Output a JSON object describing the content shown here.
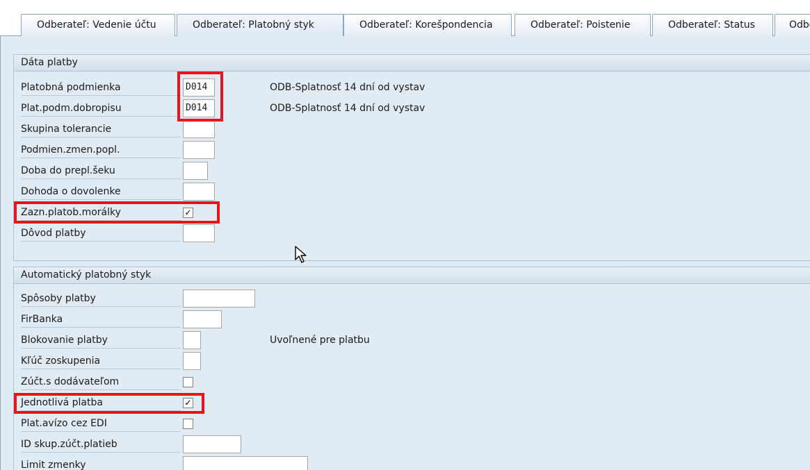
{
  "tabs": [
    {
      "label": "Odberateľ: Vedenie účtu",
      "active": false
    },
    {
      "label": "Odberateľ: Platobný styk",
      "active": true
    },
    {
      "label": "Odberateľ: Korešpondencia",
      "active": false
    },
    {
      "label": "Odberateľ: Poistenie",
      "active": false
    },
    {
      "label": "Odberateľ: Status",
      "active": false
    },
    {
      "label": "Odbe",
      "active": false
    }
  ],
  "payment_data": {
    "title": "Dáta platby",
    "fields": [
      {
        "label": "Platobná podmienka",
        "value": "D014",
        "description": "ODB-Splatnosť 14 dní od vystav"
      },
      {
        "label": "Plat.podm.dobropisu",
        "value": "D014",
        "description": "ODB-Splatnosť 14 dní od vystav"
      },
      {
        "label": "Skupina tolerancie",
        "value": ""
      },
      {
        "label": "Podmien.zmen.popl.",
        "value": ""
      },
      {
        "label": "Doba do prepl.šeku",
        "value": ""
      },
      {
        "label": "Dohoda o dovolenke",
        "value": ""
      },
      {
        "label": "Zazn.platob.morálky",
        "checked": true
      },
      {
        "label": "Dôvod platby",
        "value": ""
      }
    ]
  },
  "auto_payment": {
    "title": "Automatický platobný styk",
    "fields": [
      {
        "label": "Spôsoby platby",
        "value": ""
      },
      {
        "label": "FirBanka",
        "value": ""
      },
      {
        "label": "Blokovanie platby",
        "value": "",
        "description": "Uvoľnené pre platbu"
      },
      {
        "label": "Kľúč zoskupenia",
        "value": ""
      },
      {
        "label": "Zúčt.s dodávateľom",
        "checked": false
      },
      {
        "label": "Jednotlivá platba",
        "checked": true
      },
      {
        "label": "Plat.avízo cez EDI",
        "checked": false
      },
      {
        "label": "ID skup.zúčt.platieb",
        "value": ""
      },
      {
        "label": "Limit zmenky",
        "value": ""
      }
    ]
  },
  "checkmark": "✓",
  "colors": {
    "highlight": "#e8141b",
    "panel": "#e1ebf4"
  }
}
